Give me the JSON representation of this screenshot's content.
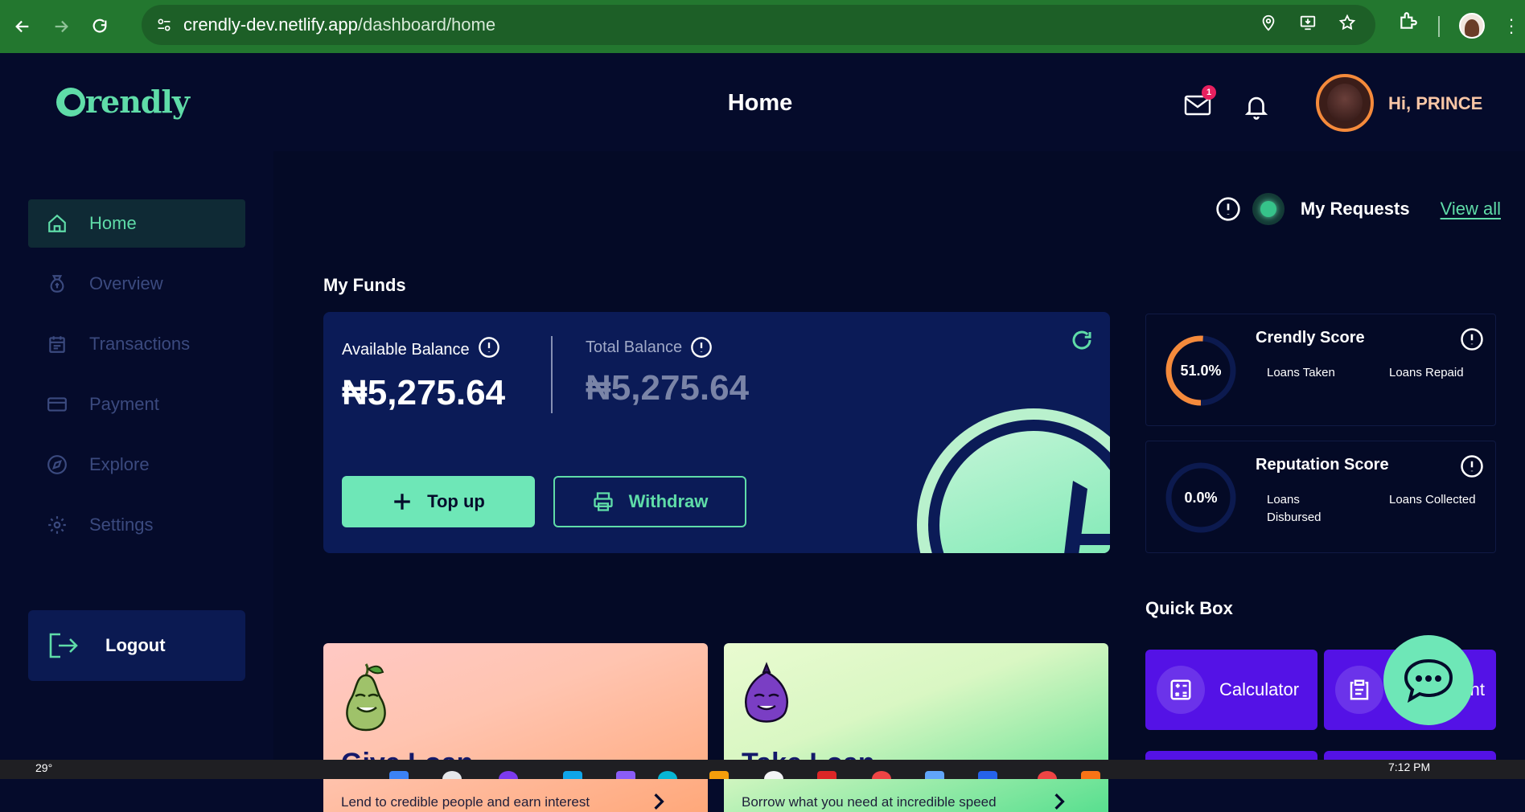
{
  "browser": {
    "url_host": "crendly-dev.netlify.app",
    "url_path": "/dashboard/home"
  },
  "header": {
    "logo_text": "rendly",
    "title": "Home",
    "mail_badge": "1",
    "greeting": "Hi, PRINCE"
  },
  "sidebar": {
    "items": [
      {
        "label": "Home",
        "icon": "home-icon",
        "active": true
      },
      {
        "label": "Overview",
        "icon": "money-bag-icon"
      },
      {
        "label": "Transactions",
        "icon": "calendar-icon"
      },
      {
        "label": "Payment",
        "icon": "card-icon"
      },
      {
        "label": "Explore",
        "icon": "compass-icon"
      },
      {
        "label": "Settings",
        "icon": "gear-icon"
      }
    ],
    "logout_label": "Logout"
  },
  "requests": {
    "label": "My Requests",
    "view_all": "View all"
  },
  "funds": {
    "title": "My Funds",
    "available_label": "Available Balance",
    "available_value": "₦5,275.64",
    "total_label": "Total Balance",
    "total_value": "₦5,275.64",
    "topup_label": "Top up",
    "withdraw_label": "Withdraw"
  },
  "loans": {
    "give": {
      "title": "Give Loan",
      "desc": "Lend to credible people and earn interest"
    },
    "take": {
      "title": "Take Loan",
      "desc": "Borrow what you need at incredible speed"
    }
  },
  "scores": {
    "crendly": {
      "title": "Crendly Score",
      "value": "51.0%",
      "percent": 51.0,
      "stat1": "Loans Taken",
      "stat2": "Loans Repaid"
    },
    "reputation": {
      "title": "Reputation Score",
      "value": "0.0%",
      "percent": 0.0,
      "stat1": "Loans Disbursed",
      "stat2": "Loans Collected"
    }
  },
  "quick_box": {
    "title": "Quick Box",
    "items": [
      {
        "label": "Calculator",
        "icon": "calculator-icon"
      },
      {
        "label": "nt",
        "icon": "clipboard-icon"
      }
    ]
  },
  "taskbar": {
    "temp": "29°",
    "time": "7:12 PM"
  },
  "colors": {
    "accent": "#5fdca8",
    "background": "#050b2b",
    "card": "#0b1b57",
    "quickbox": "#5412e6",
    "score_ring": "#f58a3b"
  }
}
